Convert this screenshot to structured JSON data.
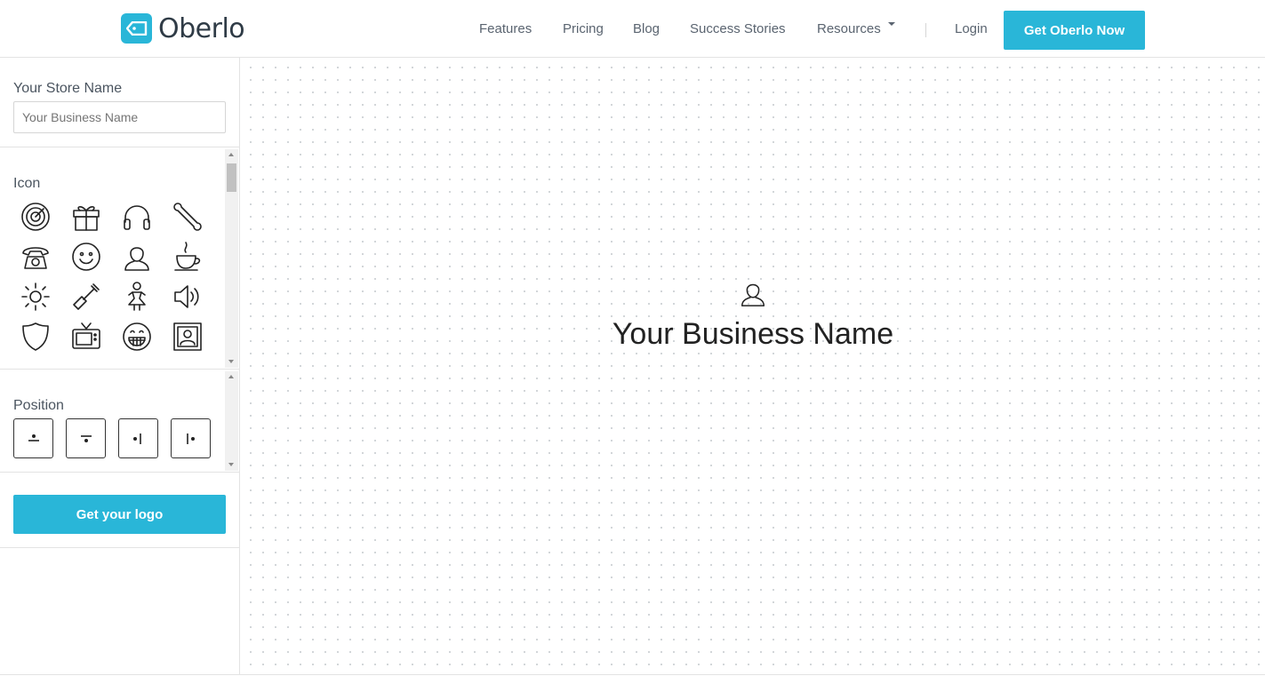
{
  "header": {
    "brand": "Oberlo",
    "nav": [
      "Features",
      "Pricing",
      "Blog",
      "Success Stories",
      "Resources"
    ],
    "login": "Login",
    "cta": "Get Oberlo Now"
  },
  "sidebar": {
    "store_label": "Your Store Name",
    "store_placeholder": "Your Business Name",
    "icon_label": "Icon",
    "icons": [
      "radar-icon",
      "gift-icon",
      "headphones-icon",
      "bone-icon",
      "telephone-icon",
      "smiley-icon",
      "person-icon",
      "coffee-cup-icon",
      "sun-icon",
      "shovel-icon",
      "girl-icon",
      "speaker-icon",
      "shield-icon",
      "tv-icon",
      "grin-icon",
      "portrait-icon"
    ],
    "position_label": "Position",
    "positions": [
      "icon-top-position",
      "icon-bottom-position",
      "icon-left-position",
      "icon-right-position"
    ],
    "get_logo": "Get your logo"
  },
  "preview": {
    "name": "Your Business Name",
    "icon": "person-icon"
  },
  "colors": {
    "accent": "#29b6d8",
    "text": "#2f3b46"
  }
}
